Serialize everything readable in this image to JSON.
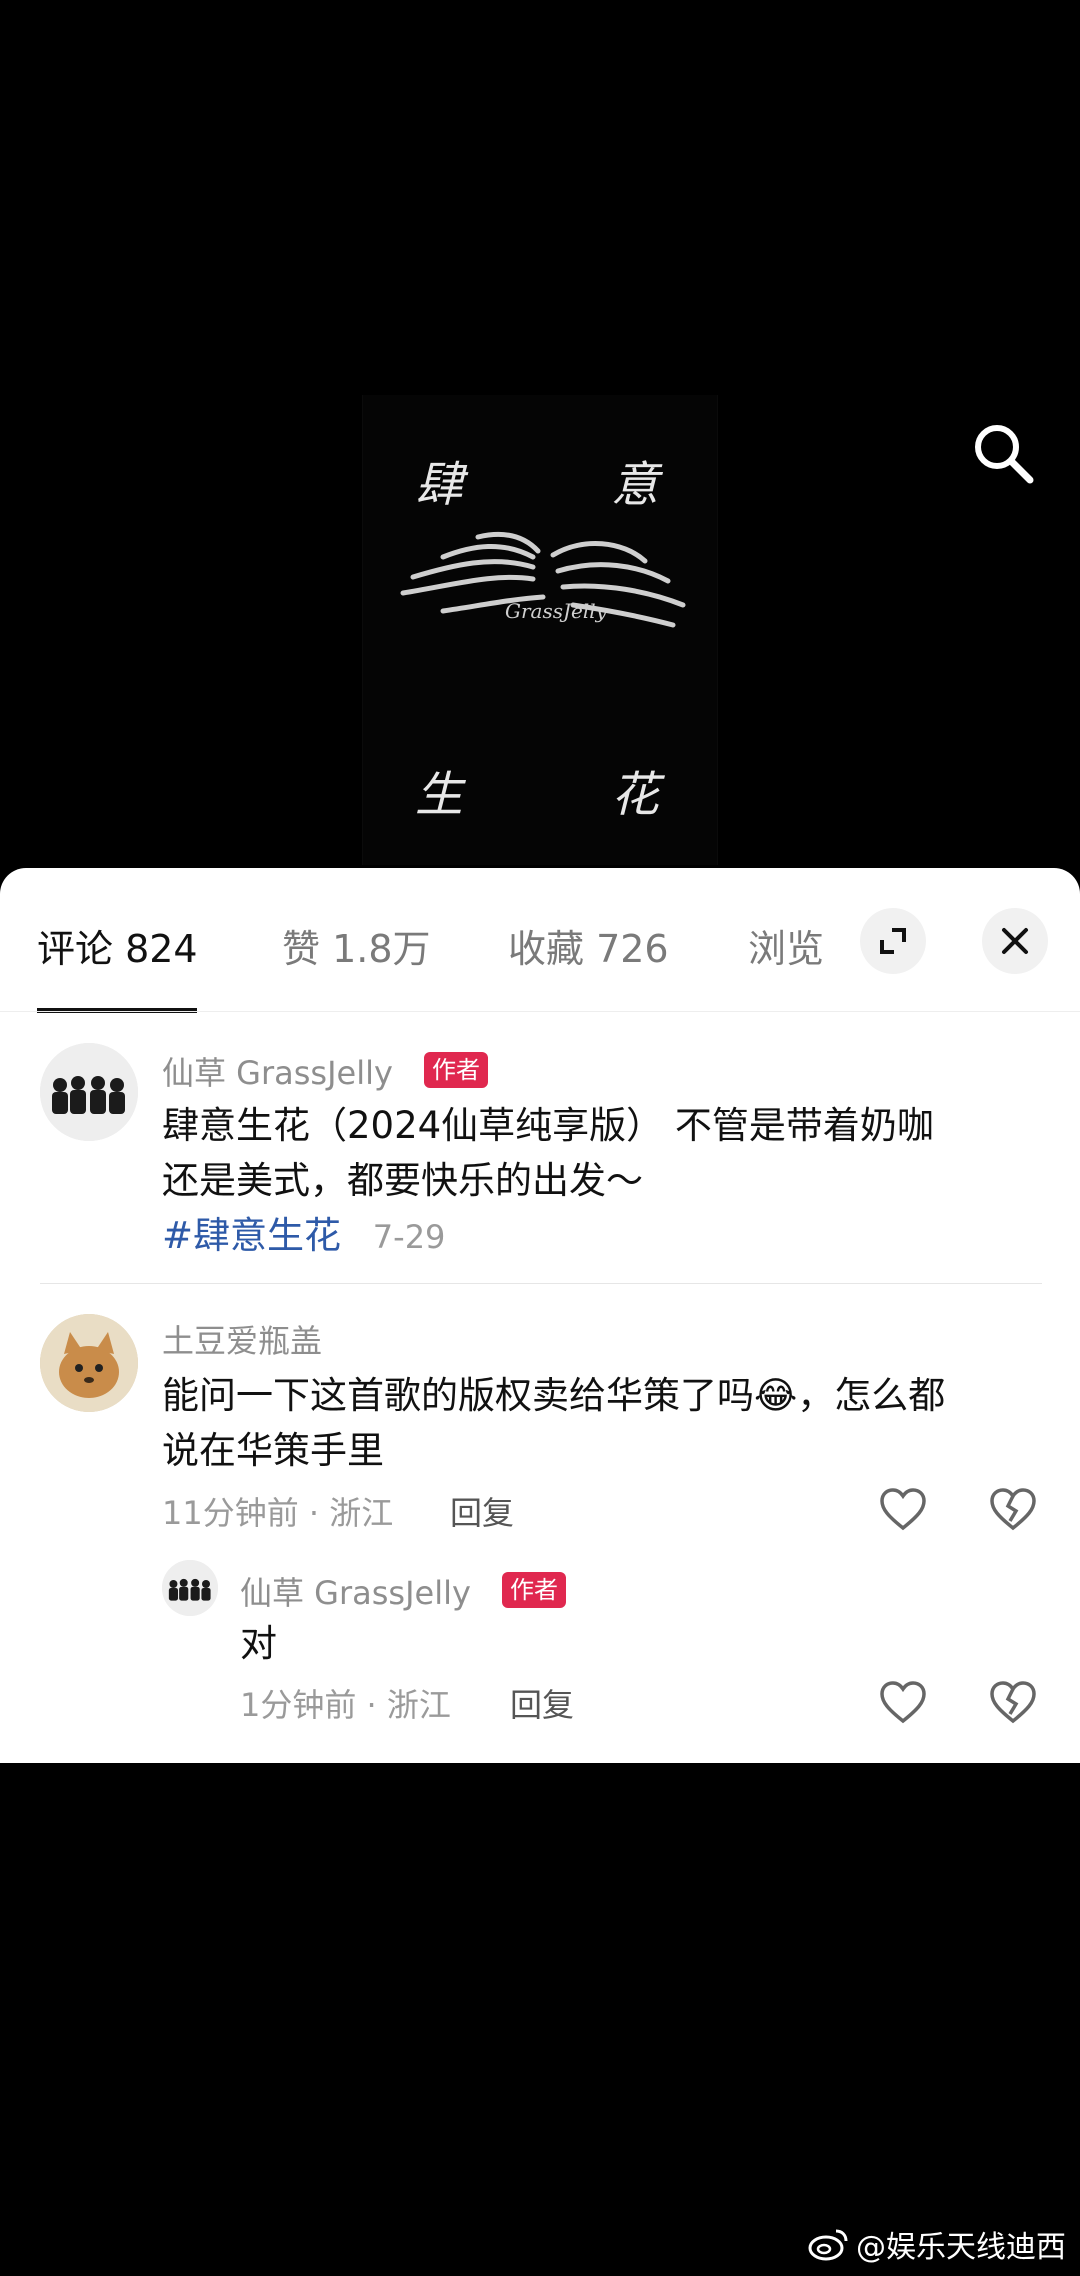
{
  "cover": {
    "chars": [
      "肆",
      "意",
      "生",
      "花"
    ],
    "logo_text": "GrassJelly"
  },
  "tabs": [
    {
      "label": "评论 824"
    },
    {
      "label": "赞 1.8万"
    },
    {
      "label": "收藏 726"
    },
    {
      "label": "浏览"
    }
  ],
  "post": {
    "author": "仙草 GrassJelly",
    "badge": "作者",
    "text_line1": "肆意生花（2024仙草纯享版） 不管是带着奶咖",
    "text_line2": "还是美式，都要快乐的出发～",
    "hashtag": "#肆意生花",
    "date": "7-29"
  },
  "comment": {
    "author": "土豆爱瓶盖",
    "text_line1": "能问一下这首歌的版权卖给华策了吗",
    "emoji": "😂",
    "text_line1_tail": "，怎么都",
    "text_line2": "说在华策手里",
    "time_location": "11分钟前 · 浙江",
    "reply_label": "回复"
  },
  "reply": {
    "author": "仙草 GrassJelly",
    "badge": "作者",
    "text": "对",
    "time_location": "1分钟前 · 浙江",
    "reply_label": "回复"
  },
  "watermark": {
    "text": "@娱乐天线迪西"
  }
}
